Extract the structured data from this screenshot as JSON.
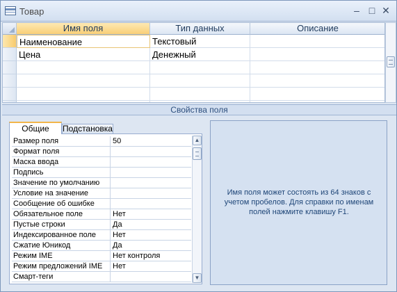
{
  "window": {
    "title": "Товар",
    "icon": "table-icon",
    "controls": {
      "minimize": "–",
      "maximize": "□",
      "close": "✕"
    }
  },
  "grid": {
    "columns": [
      "Имя поля",
      "Тип данных",
      "Описание"
    ],
    "rows": [
      {
        "name": "Наименование",
        "type": "Текстовый",
        "description": ""
      },
      {
        "name": "Цена",
        "type": "Денежный",
        "description": ""
      }
    ],
    "empty_rows": 4
  },
  "section_caption": "Свойства поля",
  "tabs": {
    "general": "Общие",
    "lookup": "Подстановка"
  },
  "properties": [
    {
      "label": "Размер поля",
      "value": "50"
    },
    {
      "label": "Формат поля",
      "value": ""
    },
    {
      "label": "Маска ввода",
      "value": ""
    },
    {
      "label": "Подпись",
      "value": ""
    },
    {
      "label": "Значение по умолчанию",
      "value": ""
    },
    {
      "label": "Условие на значение",
      "value": ""
    },
    {
      "label": "Сообщение об ошибке",
      "value": ""
    },
    {
      "label": "Обязательное поле",
      "value": "Нет"
    },
    {
      "label": "Пустые строки",
      "value": "Да"
    },
    {
      "label": "Индексированное поле",
      "value": "Нет"
    },
    {
      "label": "Сжатие Юникод",
      "value": "Да"
    },
    {
      "label": "Режим IME",
      "value": "Нет контроля"
    },
    {
      "label": "Режим предложений IME",
      "value": "Нет"
    },
    {
      "label": "Смарт-теги",
      "value": ""
    }
  ],
  "help_text": "Имя поля может состоять из 64 знаков с учетом пробелов.  Для справки по именам полей нажмите клавишу F1.",
  "colors": {
    "selection": "#f9cf76",
    "panel": "#d5e1f1",
    "help_text": "#1e4577"
  }
}
